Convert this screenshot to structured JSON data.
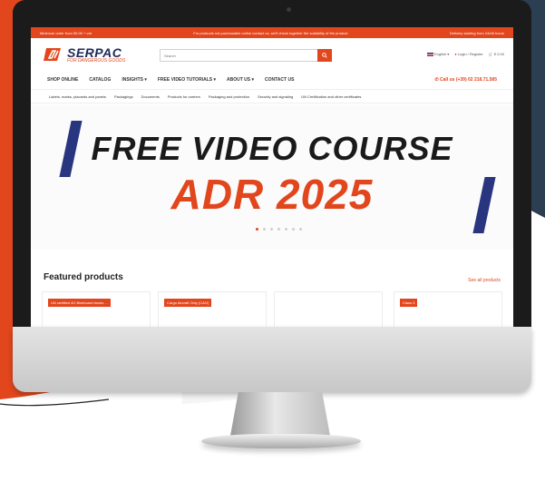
{
  "site": {
    "topbar": {
      "left": "Minimum order from 50.00 + vat",
      "center": "For products not purchasable online contact us, we'll check together the suitability of the product",
      "right": "Delivery starting from 24/48 hours"
    },
    "logo": {
      "name": "SERPAC",
      "tagline": "FOR DANGEROUS GOODS"
    },
    "search": {
      "placeholder": "Search"
    },
    "header_right": {
      "language": "English",
      "account": "Login / Register",
      "cart": "€ 0.00"
    },
    "nav": {
      "items": [
        "SHOP ONLINE",
        "CATALOG",
        "INSIGHTS",
        "FREE VIDEO TUTORIALS",
        "ABOUT US",
        "CONTACT US"
      ],
      "phone": "Call us (+39) 02 218.71.585"
    },
    "subnav": [
      "Labels, marks, placards and panels",
      "Packagings",
      "Documents",
      "Products for carriers",
      "Packaging and protection",
      "Security and signaling",
      "UN Certification and other certificates"
    ],
    "hero": {
      "line1": "FREE VIDEO COURSE",
      "line2": "ADR 2025",
      "slides": 7,
      "active_slide": 1
    },
    "featured": {
      "title": "Featured products",
      "see_all": "See all products",
      "cards": [
        {
          "badge": "UN certified 4G fibreboard boxes ..."
        },
        {
          "badge": "Cargo Aircraft Only (CAO)"
        },
        {
          "badge": ""
        },
        {
          "badge": "Class 3"
        }
      ]
    }
  },
  "colors": {
    "brand_orange": "#e2461d",
    "brand_navy": "#1c2a5a",
    "stripe_blue": "#2a3580"
  }
}
